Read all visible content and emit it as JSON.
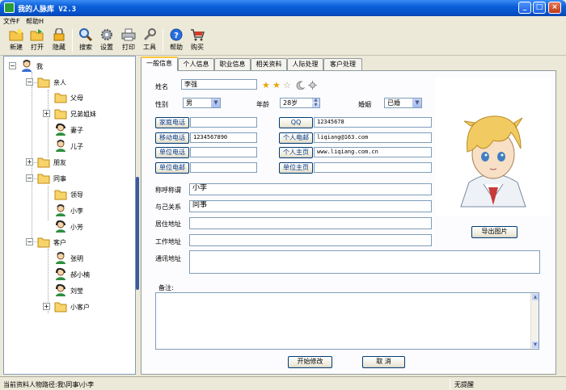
{
  "window": {
    "title": "我的人脉库 V2.3",
    "min": "_",
    "max": "□",
    "close": "×"
  },
  "menu": [
    "文件F",
    "帮助H"
  ],
  "toolbar": [
    {
      "label": "新建",
      "icon": "folder-new-icon"
    },
    {
      "label": "打开",
      "icon": "folder-open-icon"
    },
    {
      "label": "隐藏",
      "icon": "lock-icon"
    },
    {
      "label": "搜索",
      "icon": "search-icon"
    },
    {
      "label": "设置",
      "icon": "gear-icon"
    },
    {
      "label": "打印",
      "icon": "printer-icon"
    },
    {
      "label": "工具",
      "icon": "wrench-icon"
    },
    {
      "label": "帮助",
      "icon": "help-icon"
    },
    {
      "label": "购买",
      "icon": "cart-icon"
    }
  ],
  "tree": {
    "root": "我",
    "groups": [
      {
        "label": "亲人",
        "children": [
          "父母",
          "兄弟姐妹",
          "妻子",
          "儿子"
        ]
      },
      {
        "label": "朋友",
        "children": []
      },
      {
        "label": "同事",
        "children": [
          "领导",
          "小李",
          "小芳"
        ]
      },
      {
        "label": "客户",
        "children": [
          "张明",
          "郝小楠",
          "刘莹",
          "小客户"
        ]
      }
    ],
    "expand_plus": "+",
    "expand_minus": "−"
  },
  "tabs": [
    "一般信息",
    "个人信息",
    "职业信息",
    "相关资料",
    "人际处理",
    "客户处理"
  ],
  "form": {
    "name_label": "姓名",
    "name_value": "李强",
    "stars": "★★☆",
    "gender_label": "性别",
    "gender_value": "男",
    "age_label": "年龄",
    "age_value": "28岁",
    "marriage_label": "婚姻",
    "marriage_value": "已婚",
    "btn_home_phone": "家庭电话",
    "home_phone": "",
    "btn_qq": "QQ",
    "qq": "12345678",
    "btn_mobile": "移动电话",
    "mobile": "1234567890",
    "btn_email": "个人电邮",
    "email": "liqiang@163.com",
    "btn_work_phone": "单位电话",
    "work_phone": "",
    "btn_homepage": "个人主页",
    "homepage": "www.liqiang.com.cn",
    "btn_work_email": "单位电邮",
    "work_email": "",
    "btn_company_site": "单位主页",
    "company_site": "",
    "nickname_label": "称呼称谓",
    "nickname_value": "小李",
    "relation_label": "与己关系",
    "relation_value": "同事",
    "address_label": "居住地址",
    "address_value": "",
    "work_address_label": "工作地址",
    "work_address_value": "",
    "mail_address_label": "通讯地址",
    "mail_address_value": "",
    "notes_label": "备注:",
    "export_photo": "导出图片",
    "edit_btn": "开始修改",
    "cancel_btn": "取 消"
  },
  "status": {
    "path": "当前资料人物路径:我\\同事\\小李",
    "right": "无提醒"
  },
  "colors": {
    "titlebar": "#0a5fd8",
    "tab_accent": "#ffc83c",
    "button_text": "#0b3a8a"
  }
}
